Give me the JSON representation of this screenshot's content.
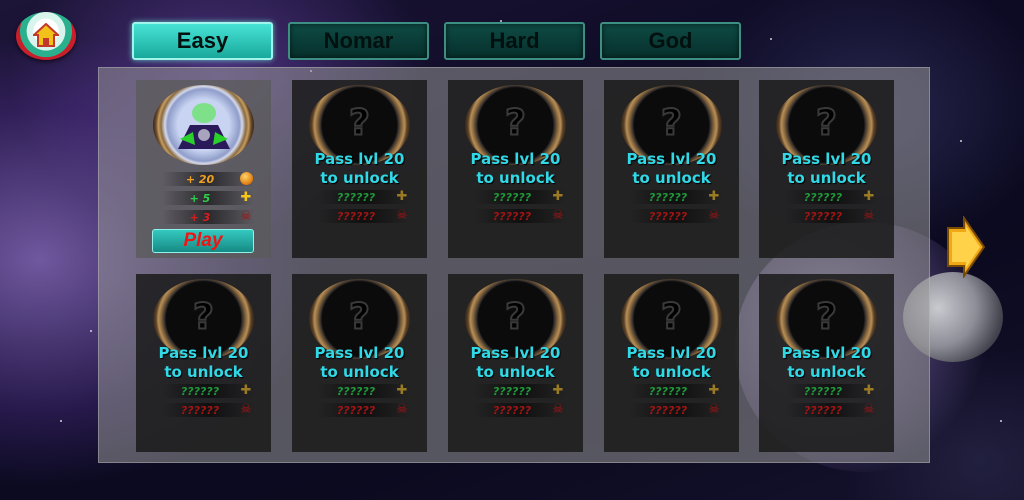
{
  "tabs": [
    {
      "label": "Easy",
      "active": true
    },
    {
      "label": "Nomar",
      "active": false
    },
    {
      "label": "Hard",
      "active": false
    },
    {
      "label": "God",
      "active": false
    }
  ],
  "unlocked": {
    "stat1": "+ 20",
    "stat2": "+ 5",
    "stat3": "+ 3",
    "play_label": "Play"
  },
  "locked": {
    "line1": "Pass lvl 20",
    "line2": "to unlock",
    "stat_green": "??????",
    "stat_red": "??????",
    "portrait": "?"
  },
  "colors": {
    "accent_teal": "#47e3d5",
    "unlock_text": "#31d8e6",
    "play_text": "#f01414"
  },
  "icons": {
    "home": "home-icon",
    "next": "next-arrow-icon",
    "coin": "coin-icon",
    "plus": "plus-icon",
    "skull": "skull-icon"
  }
}
